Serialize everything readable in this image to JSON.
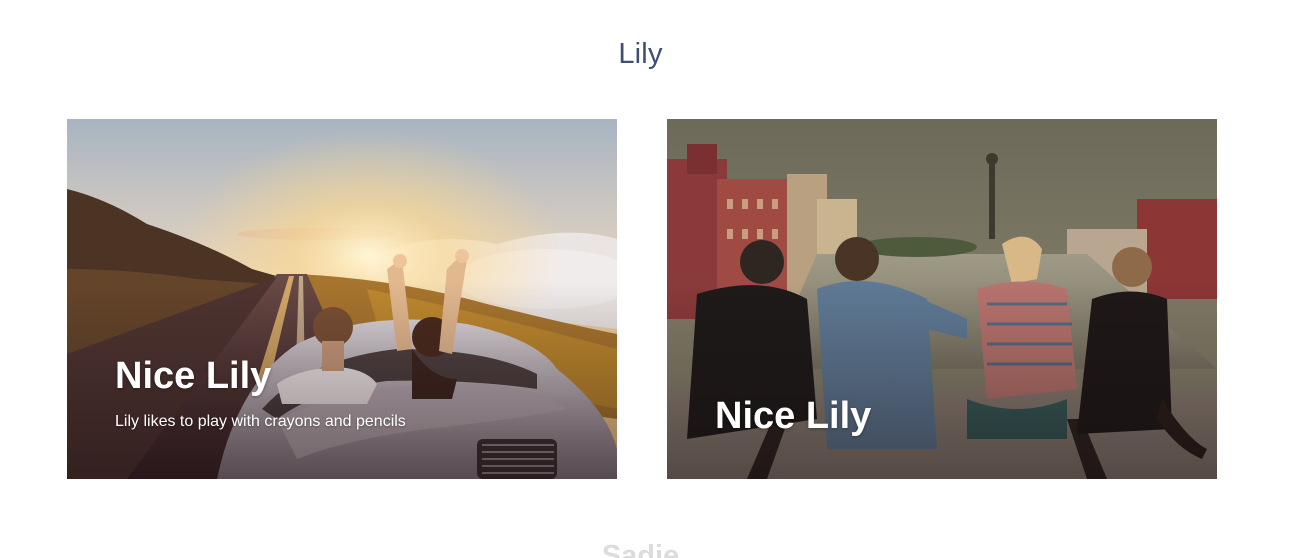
{
  "section": {
    "title": "Lily"
  },
  "cards": [
    {
      "title": "Nice Lily",
      "subtitle": "Lily likes to play with crayons and pencils",
      "image_icon": "convertible-sunset-photo"
    },
    {
      "title": "Nice Lily",
      "image_icon": "friends-by-river-photo"
    }
  ],
  "next_section": {
    "title": "Sadie"
  },
  "colors": {
    "title": "#3d4f73",
    "card_text": "#ffffff"
  }
}
